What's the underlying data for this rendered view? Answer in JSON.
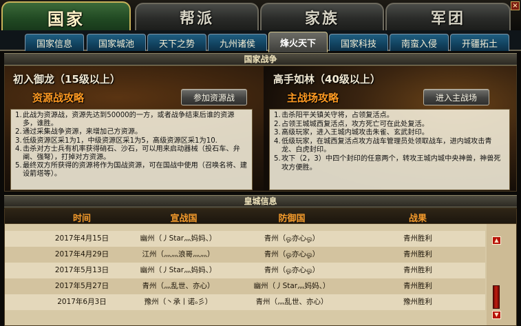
{
  "main_tabs": [
    "国家",
    "帮派",
    "家族",
    "军团"
  ],
  "close_glyph": "×",
  "sub_tabs": [
    "国家信息",
    "国家城池",
    "天下之势",
    "九州诸侯",
    "烽火天下",
    "国家科技",
    "南蛮入侵",
    "开疆拓土"
  ],
  "active_sub_tab": "烽火天下",
  "war": {
    "header": "国家战争",
    "left": {
      "title": "初入御龙（15级以上）",
      "subtitle": "资源战攻略",
      "button": "参加资源战",
      "items": [
        "此战为资源战，资源先达到50000的一方，或者战争结束后谁的资源多，谁胜。",
        "通过采集战争资源，来增加己方资源。",
        "低级资源区采1为1，中级资源区采1为5，高级资源区采1为10.",
        "击杀对方士兵有机率获得硝石、沙石，可以用来启动器械（投石车、弁阐、强弩），打掉对方资源。",
        "最终双方所获得的资源将作为国战资源，可在国战中使用（召唤名将、建设箭塔等）。"
      ]
    },
    "right": {
      "title": "高手如林（40级以上）",
      "subtitle": "主战场攻略",
      "button": "进入主战场",
      "items": [
        "击杀阳平关镇关守将，占领复活点。",
        "占领王城城西复活点，攻方死亡可在此处复活。",
        "高级玩家，进入王城内城攻击朱雀、玄武封印。",
        "低级玩家，在城西复活点攻方战车管理员处领取战车，进内城攻击青龙、白虎封印。",
        "攻下（2，3）中四个封印的任意两个，转攻王城内城中央神兽，神兽死攻方便胜。"
      ]
    }
  },
  "city": {
    "header": "皇城信息",
    "columns": [
      "时间",
      "宣战国",
      "防御国",
      "战果"
    ],
    "rows": [
      {
        "time": "2017年4月15日",
        "attacker": "幽州（丿Star灬妈妈、）",
        "defender": "青州（ஓ亦心ஓ）",
        "result": "青州胜利"
      },
      {
        "time": "2017年4月29日",
        "attacker": "江州（灬灬浪哥灬灬）",
        "defender": "青州（ஓ亦心ஓ）",
        "result": "青州胜利"
      },
      {
        "time": "2017年5月13日",
        "attacker": "幽州（丿Star灬妈妈、）",
        "defender": "青州（ஓ亦心ஓ）",
        "result": "青州胜利"
      },
      {
        "time": "2017年5月27日",
        "attacker": "青州（灬乱世、亦心）",
        "defender": "幽州（丿Star灬妈妈、）",
        "result": "青州胜利"
      },
      {
        "time": "2017年6月3日",
        "attacker": "豫州（丶承丨诺ₒ彡）",
        "defender": "青州（灬乱世、亦心）",
        "result": "豫州胜利"
      }
    ]
  },
  "scroll": {
    "up_glyph": "▲",
    "down_glyph": "▼"
  }
}
